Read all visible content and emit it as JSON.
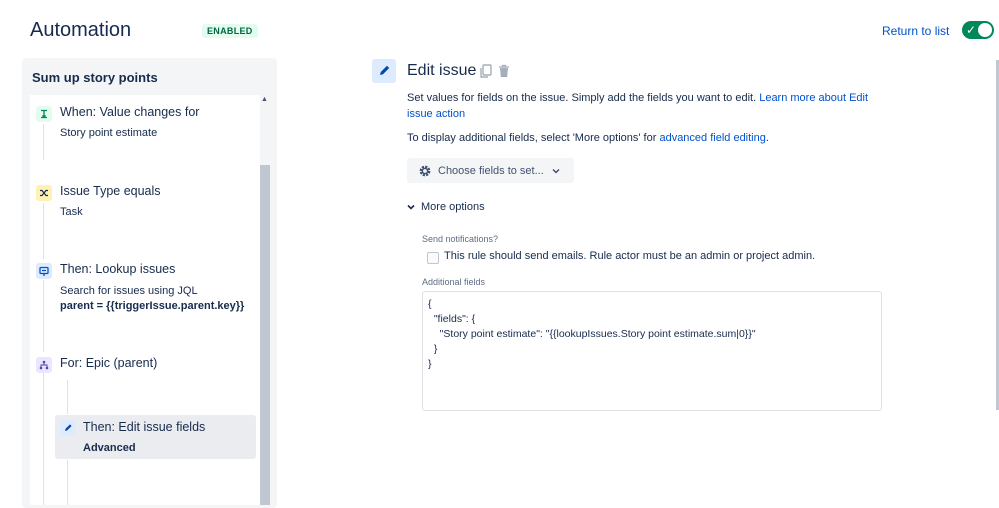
{
  "header": {
    "title": "Automation",
    "status_badge": "ENABLED",
    "return_link": "Return to list",
    "toggle_state": "on",
    "toggle_check": "✓"
  },
  "rule": {
    "name": "Sum up story points",
    "steps": [
      {
        "title": "When: Value changes for",
        "subtitle": "Story point estimate",
        "icon": "trigger-icon"
      },
      {
        "title": "Issue Type equals",
        "subtitle": "Task",
        "icon": "condition-icon"
      },
      {
        "title": "Then: Lookup issues",
        "subtitle": "Search for issues using JQL",
        "detail": "parent = {{triggerIssue.parent.key}}",
        "icon": "lookup-icon"
      },
      {
        "title": "For: Epic (parent)",
        "icon": "branch-icon"
      },
      {
        "title": "Then: Edit issue fields",
        "subtitle": "Advanced",
        "icon": "pencil-icon"
      }
    ]
  },
  "editor": {
    "title": "Edit issue",
    "description": "Set values for fields on the issue. Simply add the fields you want to edit.",
    "learn_more_link": "Learn more about Edit issue action",
    "advanced_prefix": "To display additional fields, select 'More options' for",
    "advanced_link": "advanced field editing",
    "advanced_suffix": ".",
    "choose_fields_button": "Choose fields to set...",
    "more_options": "More options",
    "send_notifications_label": "Send notifications?",
    "send_notifications_checkbox": "This rule should send emails. Rule actor must be an admin or project admin.",
    "additional_fields_label": "Additional fields",
    "additional_fields_json": "{\n  \"fields\": {\n    \"Story point estimate\": \"{{lookupIssues.Story point estimate.sum|0}}\"\n  }\n}"
  },
  "colors": {
    "accent": "#0052cc",
    "enabled_green": "#00875a",
    "trigger_green": "#e3fcef",
    "condition_yellow": "#fff0b3",
    "action_blue": "#deebff",
    "branch_purple": "#eae6ff"
  }
}
